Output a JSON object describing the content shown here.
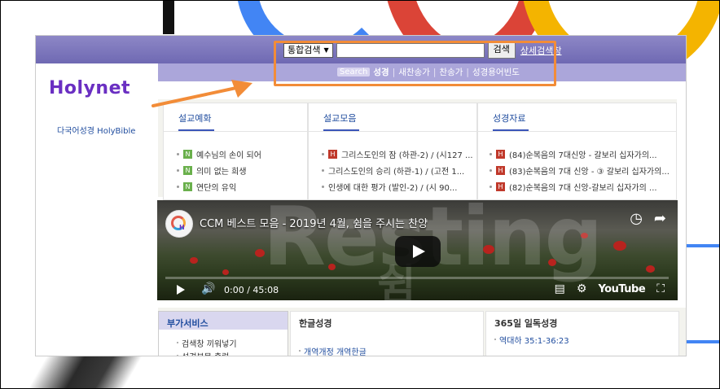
{
  "logo": "Holynet",
  "multilang_link": "다국어성경 HolyBible",
  "search": {
    "scope_selected": "통합검색",
    "placeholder": "",
    "button": "검색",
    "advanced": "상세검색창"
  },
  "subnav": {
    "badge": "Search",
    "items": [
      "성경",
      "새찬송가",
      "찬송가",
      "성경용어빈도"
    ]
  },
  "cards": [
    {
      "title": "설교예화",
      "items": [
        {
          "tag": "N",
          "text": "예수님의 손이 되어"
        },
        {
          "tag": "N",
          "text": "의미 없는 희생"
        },
        {
          "tag": "N",
          "text": "연단의 유익"
        }
      ]
    },
    {
      "title": "설교모음",
      "items": [
        {
          "tag": "H",
          "text": "그리스도인의 잠 (하관-2) / (시127 ..."
        },
        {
          "tag": "",
          "text": "그리스도인의 승리 (하관-1) / (고전 1..."
        },
        {
          "tag": "",
          "text": "인생에 대한 평가 (발인-2) / (시 90..."
        }
      ]
    },
    {
      "title": "성경자료",
      "items": [
        {
          "tag": "H",
          "text": "(84)순복음의 7대신앙 - 갈보리 십자가의..."
        },
        {
          "tag": "H",
          "text": "(83)순복음의 7대 신앙 - ③ 갈보리 십자가의..."
        },
        {
          "tag": "H",
          "text": "(82)순복음의 7대 신앙-갈보리 십자가의 ..."
        }
      ]
    }
  ],
  "video": {
    "title": "CCM 베스트 모음 - 2019년 4월, 쉼을 주시는 찬양",
    "overlay_text": "Resting",
    "overlay_text_ko": "쉼",
    "time": "0:00 / 45:08",
    "brand": "YouTube",
    "progress_fraction": 0
  },
  "bottom": [
    {
      "title": "부가서비스",
      "items": [
        "검색창 끼워넣기",
        "성경본문 출력"
      ]
    },
    {
      "title": "한글성경",
      "items": [
        "개역개정 개역한글"
      ]
    },
    {
      "title": "365일 일독성경",
      "items": [
        "역대하 35:1-36:23"
      ]
    }
  ],
  "colors": {
    "highlight": "#f28c38",
    "topbar": "#7a74ba",
    "logo": "#6a2fc2"
  }
}
